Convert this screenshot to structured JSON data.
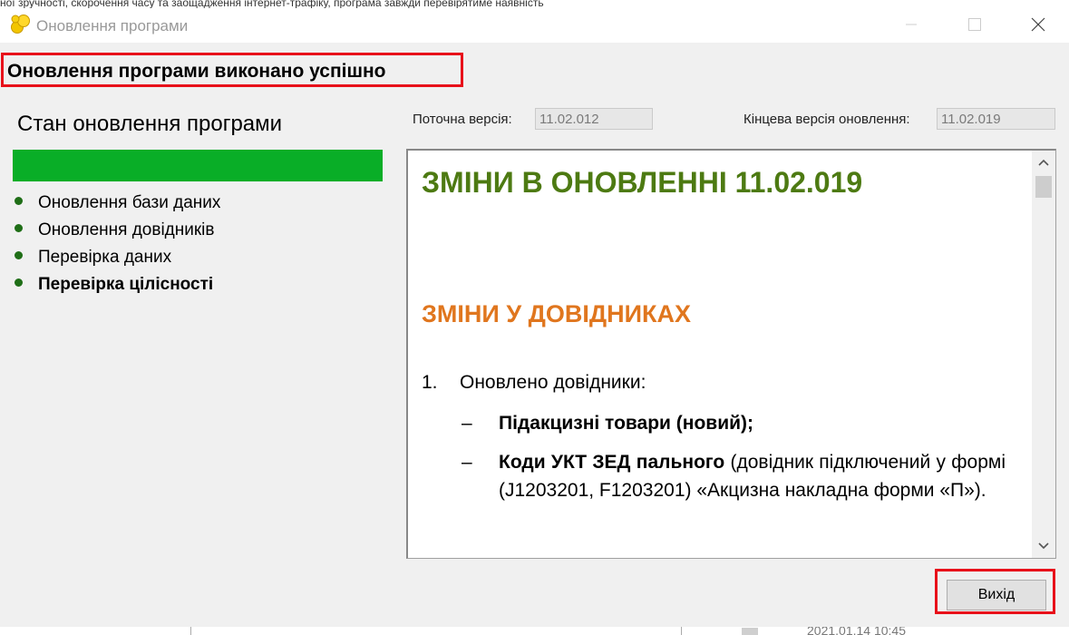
{
  "background": {
    "top_text": "ної зручності, скорочення часу та заощадження інтернет-трафіку, програма завжди перевірятиме наявність",
    "timestamp": "2021.01.14 10:45"
  },
  "window": {
    "title": "Оновлення програми",
    "icon": "app-logo-icon"
  },
  "header": {
    "status_title": "Оновлення програми виконано успішно"
  },
  "progress": {
    "section_title": "Стан оновлення програми",
    "fill_fraction": 1.0,
    "color": "#09ae27",
    "steps": [
      {
        "label": "Оновлення бази даних",
        "bold": false
      },
      {
        "label": "Оновлення довідників",
        "bold": false
      },
      {
        "label": "Перевірка даних",
        "bold": false
      },
      {
        "label": "Перевірка цілісності",
        "bold": true
      }
    ]
  },
  "versions": {
    "current_label": "Поточна версія:",
    "current_value": "11.02.012",
    "final_label": "Кінцева версія оновлення:",
    "final_value": "11.02.019"
  },
  "content": {
    "heading": "ЗМІНИ В ОНОВЛЕННІ 11.02.019",
    "subheading": "ЗМІНИ У ДОВІДНИКАХ",
    "item_number": "1.",
    "item_text": "Оновлено довідники:",
    "dash": "–",
    "sub1_bold": "Підакцизні товари (новий);",
    "sub2_bold": "Коди УКТ ЗЕД пального",
    "sub2_rest": " (довідник підключений у формі (J1203201, F1203201) «Акцизна накладна форми «П»).",
    "heading_color": "#4d7a12",
    "subheading_color": "#e0761e"
  },
  "buttons": {
    "exit_label": "Вихід"
  }
}
